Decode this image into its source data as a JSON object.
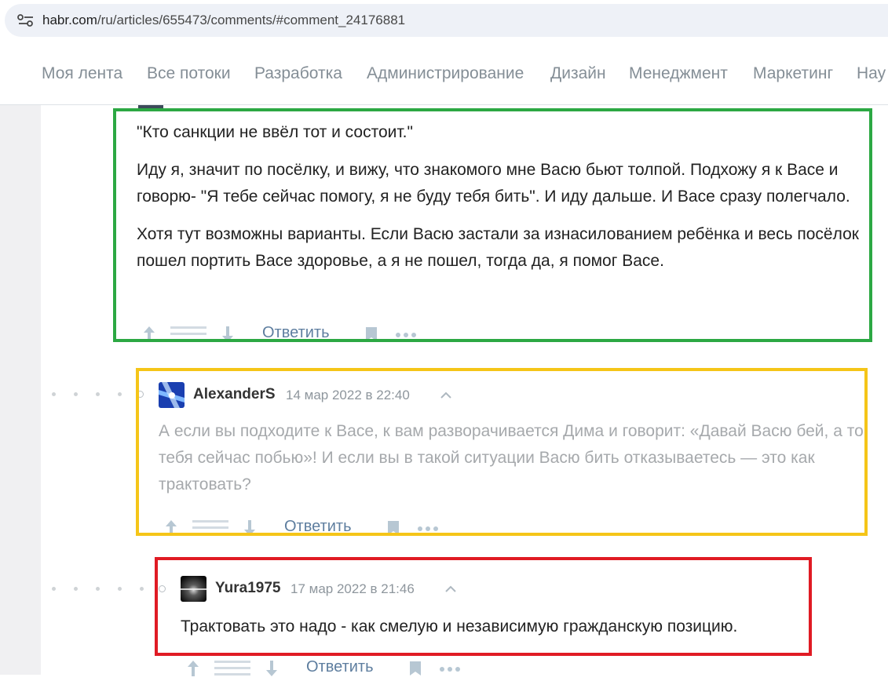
{
  "browser": {
    "url_host": "habr.com",
    "url_path": "/ru/articles/655473/comments/#comment_24176881"
  },
  "nav": {
    "items": [
      "Моя лента",
      "Все потоки",
      "Разработка",
      "Администрирование",
      "Дизайн",
      "Менеджмент",
      "Маркетинг",
      "Нау"
    ]
  },
  "comments": [
    {
      "paragraphs": [
        "\"Кто санкции не ввёл тот и состоит.\"",
        "Иду я, значит по посёлку, и вижу, что знакомого мне Васю бьют толпой. Подхожу я к Васе и говорю- \"Я тебе сейчас помогу, я не буду тебя бить\". И иду дальше. И Васе сразу полегчало.",
        "Хотя тут возможны варианты. Если Васю застали за изнасилованием ребёнка и весь посёлок пошел портить Васе здоровье, а я не пошел, тогда да, я помог Васе."
      ],
      "reply_label": "Ответить"
    },
    {
      "username": "AlexanderS",
      "date": "14 мар 2022 в 22:40",
      "text": "А если вы подходите к Васе, к вам разворачивается Дима и говорит: «Давай Васю бей, а то тебя сейчас побью»! И если вы в такой ситуации Васю бить отказываетесь — это как трактовать?",
      "reply_label": "Ответить"
    },
    {
      "username": "Yura1975",
      "date": "17 мар 2022 в 21:46",
      "text": "Трактовать это надо - как смелую и независимую гражданскую позицию.",
      "reply_label": "Ответить"
    }
  ],
  "colors": {
    "highlight_green": "#2ca843",
    "highlight_yellow": "#f5c518",
    "highlight_red": "#e01b24",
    "link": "#5e7e9f"
  },
  "icons": [
    "site-settings-icon",
    "upvote-arrow-icon",
    "score-placeholder-icon",
    "downvote-arrow-icon",
    "bookmark-icon",
    "more-dots-icon",
    "collapse-chevron-icon"
  ]
}
